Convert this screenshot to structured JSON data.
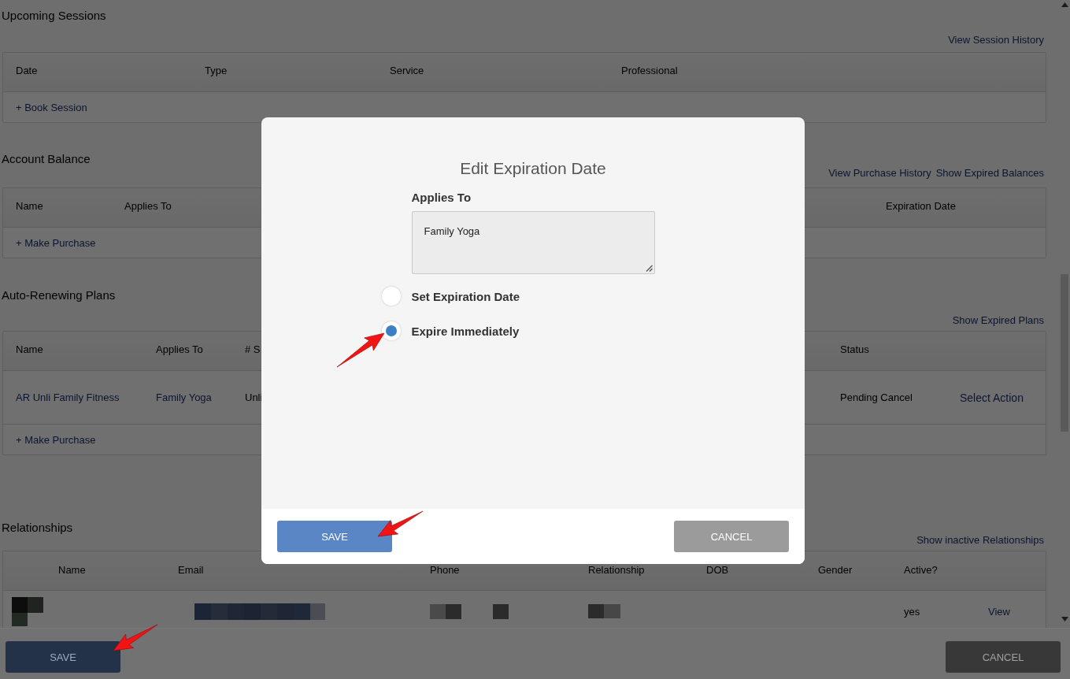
{
  "sections": [
    {
      "title": "Upcoming Sessions",
      "links": [
        "View Session History"
      ],
      "columns": [
        "Date",
        "Type",
        "Service",
        "Professional"
      ],
      "add_link": "+ Book Session"
    },
    {
      "title": "Account Balance",
      "links": [
        "View Purchase History",
        "Show Expired Balances"
      ],
      "columns": [
        "Name",
        "Applies To",
        "Expiration Date"
      ],
      "add_link": "+ Make Purchase"
    },
    {
      "title": "Auto-Renewing Plans",
      "links": [
        "Show Expired Plans"
      ],
      "columns": [
        "Name",
        "Applies To",
        "# S",
        "Status"
      ],
      "rows": [
        {
          "cells": [
            {
              "kind": "link",
              "text": "AR Unli Family Fitness"
            },
            {
              "kind": "link",
              "text": "Family Yoga"
            },
            {
              "kind": "text",
              "text": "Unli"
            },
            {
              "kind": "text",
              "text": "Pending Cancel"
            },
            {
              "kind": "action",
              "text": "Select Action"
            }
          ]
        }
      ],
      "add_link": "+ Make Purchase"
    },
    {
      "title": "Relationships",
      "links": [
        "Show inactive Relationships"
      ],
      "columns": [
        "Name",
        "Email",
        "Phone",
        "Relationship",
        "DOB",
        "Gender",
        "Active?"
      ],
      "rows": [
        {
          "cells": [
            {
              "kind": "redacted"
            },
            {
              "kind": "redacted"
            },
            {
              "kind": "redacted"
            },
            {
              "kind": "redacted"
            },
            {
              "kind": "empty"
            },
            {
              "kind": "empty"
            },
            {
              "kind": "text",
              "text": "yes"
            },
            {
              "kind": "link",
              "text": "View"
            }
          ]
        }
      ]
    }
  ],
  "footer": {
    "buttons": [
      {
        "label": "SAVE",
        "kind": "primary"
      },
      {
        "label": "CANCEL",
        "kind": "secondary"
      }
    ]
  },
  "dialog": {
    "title": "Edit Expiration Date",
    "field": {
      "label": "Applies To",
      "value": "Family Yoga"
    },
    "options": [
      {
        "label": "Set Expiration Date",
        "selected": false
      },
      {
        "label": "Expire Immediately",
        "selected": true
      }
    ],
    "buttons": [
      {
        "label": "SAVE",
        "kind": "primary"
      },
      {
        "label": "CANCEL",
        "kind": "secondary"
      }
    ]
  }
}
